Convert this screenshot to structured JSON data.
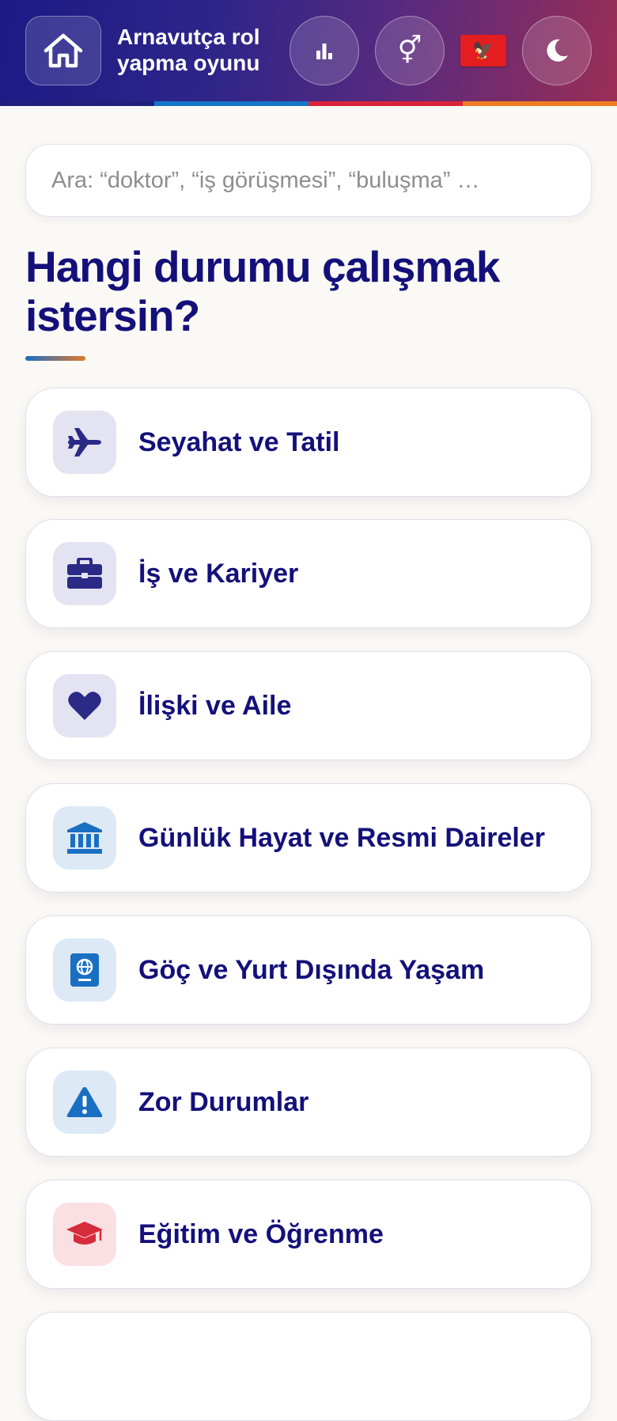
{
  "header": {
    "title": "Arnavutça rol yapma oyunu",
    "home_icon": "home-icon",
    "stats_icon": "bar-chart-icon",
    "gender_icon": "gender-symbol-icon",
    "gender_glyph": "⚥",
    "flag_icon": "albania-flag-icon",
    "flag_glyph": "🦅",
    "theme_icon": "moon-icon",
    "stripe_colors": [
      "#22207f",
      "#1576c8",
      "#d9243a",
      "#ee7d22"
    ]
  },
  "search": {
    "placeholder": "Ara: “doktor”, “iş görüşmesi”, “buluşma” …",
    "value": ""
  },
  "main": {
    "heading": "Hangi durumu çalışmak istersin?",
    "categories": [
      {
        "label": "Seyahat ve Tatil",
        "icon": "airplane-icon",
        "accent": "#2b2a87"
      },
      {
        "label": "İş ve Kariyer",
        "icon": "briefcase-icon",
        "accent": "#2b2a87"
      },
      {
        "label": "İlişki ve Aile",
        "icon": "heart-icon",
        "accent": "#2b2a87"
      },
      {
        "label": "Günlük Hayat ve Resmi Daireler",
        "icon": "bank-building-icon",
        "accent": "#1a6fc2"
      },
      {
        "label": "Göç ve Yurt Dışında Yaşam",
        "icon": "passport-icon",
        "accent": "#1a6fc2"
      },
      {
        "label": "Zor Durumlar",
        "icon": "warning-icon",
        "accent": "#1a6fc2"
      },
      {
        "label": "Eğitim ve Öğrenme",
        "icon": "graduation-cap-icon",
        "accent": "#d62b3b"
      }
    ]
  }
}
